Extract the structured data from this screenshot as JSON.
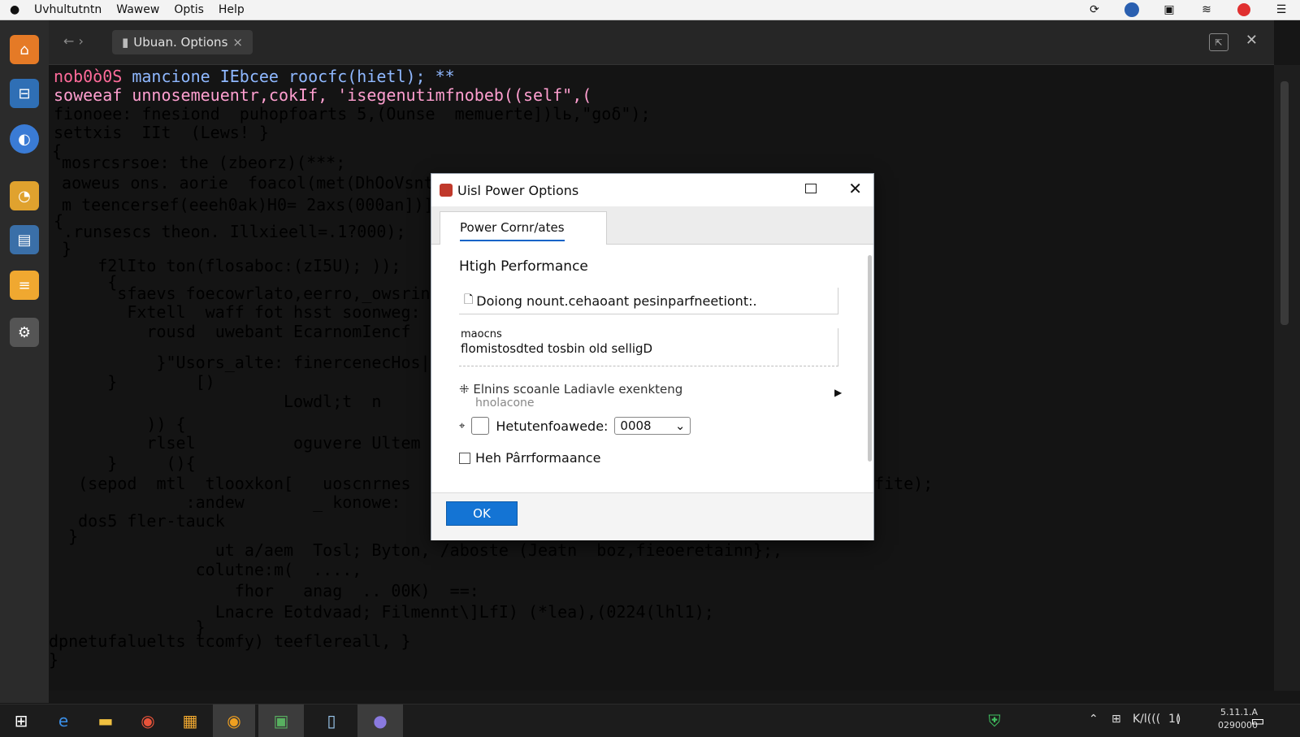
{
  "menubar": {
    "apple": "",
    "items": [
      "Uvhultutntn",
      "Wawew",
      "Optis",
      "Help"
    ],
    "right_icons": [
      "refresh-icon",
      "browser-icon",
      "display-icon",
      "wifi-icon",
      "notification-icon",
      "menu-icon"
    ]
  },
  "dock": {
    "icons": [
      "home-icon",
      "editor-icon",
      "browser-icon",
      "chrome-icon",
      "files-icon",
      "notes-icon",
      "settings-icon"
    ]
  },
  "terminal": {
    "tab_label": "Ubuan. Options",
    "tab_close": "×",
    "nav_back": "←",
    "nav_forward": "›",
    "lock": "🔒",
    "lines": [
      {
        "text": "nob0ò0S",
        "color": "#ff6b9a"
      },
      {
        "text": "mancione IEbcee roocfc(hietl); **",
        "color": "#8fb8ff"
      },
      {
        "text": "soweeaf",
        "color": "#ff9fd0"
      },
      {
        "text": "unnosemeuentr,cokIf, 'isegenutimfnobeb((self\",(",
        "color": "#ff9fd0"
      },
      {
        "text": "fionoee: fnesiond  puhopfoarts 5,(Ounse  memuerte])lь,\"goδ\");",
        "color": "#ff7fb0"
      },
      {
        "text": "settxis  IIt  (Lews! }",
        "color": "#f0f0f0"
      },
      {
        "text": "{",
        "color": "#f0f0f0"
      },
      {
        "text": " mosrcsrsoe: the (zbeorz)(***;",
        "color": "#c0a0ff"
      },
      {
        "text": " aoweus ons. aorie  foacol(met(DhOoVsnta",
        "color": "#f0f0f0"
      },
      {
        "text": " m teencersef(eeeh0ak)H0= 2axs(000an])];",
        "color": "#ffd080"
      },
      {
        "text": "{",
        "color": "#f0f0f0"
      },
      {
        "text": " .runsescs theon. Illxieell=.1?000);",
        "color": "#ffd070"
      },
      {
        "text": " }",
        "color": "#f0f0f0"
      },
      {
        "text": "     f2lIto ton(flosaboc:(zI5U); ));",
        "color": "#8fd0ff"
      },
      {
        "text": "      {",
        "color": "#f0f0f0"
      },
      {
        "text": "       sfaevs foecowrlato,eerro,_owsrin",
        "color": "#ff90c0"
      },
      {
        "text": "        Fxtell  waff fot hsst soonweg:",
        "color": "#ffd070"
      },
      {
        "text": "          rousd  uwebant EcarnomIencf",
        "color": "#ff7fb0"
      },
      {
        "text": "           }\"Usors_alte: finercenecHos|m",
        "color": "#ffd070"
      },
      {
        "text": "      }        [)",
        "color": "#f0f0f0"
      },
      {
        "text": "                        Lowdl;t  n",
        "color": "#9ff09a"
      },
      {
        "text": "          )) {",
        "color": "#8fb8ff"
      },
      {
        "text": "          rlsel          oguvere Ultem",
        "color": "#9ff09a"
      },
      {
        "text": "      }     (){",
        "color": "#f0f0f0"
      },
      {
        "text": "   (sepod  mtl  tlooxkon[   uoscnrnes  m",
        "color": "#ff9fd0"
      },
      {
        "text": "              :andew       _ konowe: ",
        "color": "#9ff09a"
      },
      {
        "text": "   dos5 fler-tauck",
        "color": "#ff7fb0"
      },
      {
        "text": "  }",
        "color": "#f0f0f0"
      },
      {
        "text": "fite);",
        "color": "#ff90c0"
      },
      {
        "text": "                 ut a/aem  Tosl; Byton, /aboste (Jeatn  boz,fieoeretainn};,",
        "color": "#ffd070"
      },
      {
        "text": "               colutne:m(  ....,",
        "color": "#f0f0f0"
      },
      {
        "text": "                   fhor   anag  .. 00K)  ==:",
        "color": "#ff9fd0"
      },
      {
        "text": "                 Lnacre Eotdvaad; Filmennt\\]LfI) (*lea),(0224(lhl1);",
        "color": "#ffd070"
      },
      {
        "text": "               }",
        "color": "#f0f0f0"
      },
      {
        "text": "dpnetufaluelts tcomfy) teeflereall, }",
        "color": "#ff9fd0"
      },
      {
        "text": "}",
        "color": "#f0f0f0"
      }
    ]
  },
  "dialog": {
    "title": "Uisl Power Options",
    "tab_label": "Power  Cornr/ates",
    "plan_name": "Htigh Performance",
    "field1_value": "Doiong nount.cehaoant pesinparfneetiont:.",
    "field1_icon": "🗋",
    "area_label": "maocns",
    "area_value": "flomistosdted tosbin old selligD",
    "row3_label": "Elnins scoanle Ladiavle exenkteng",
    "row3_sub": "hnolacone",
    "row3_icon": "⁜",
    "row4_icon": "⌖",
    "row4_label": "Hetutenfoawede:",
    "row4_select": "0008",
    "row4_select_arrow": "⌄",
    "row5_label": "Heh Pârrformaance",
    "ok_label": "OK",
    "close_glyph": "✕"
  },
  "taskbar": {
    "clock_time": "5.11.1.A",
    "clock_date": "0290000",
    "tray": [
      "⌃",
      "⊞",
      "K/l(((",
      "1≬"
    ]
  }
}
